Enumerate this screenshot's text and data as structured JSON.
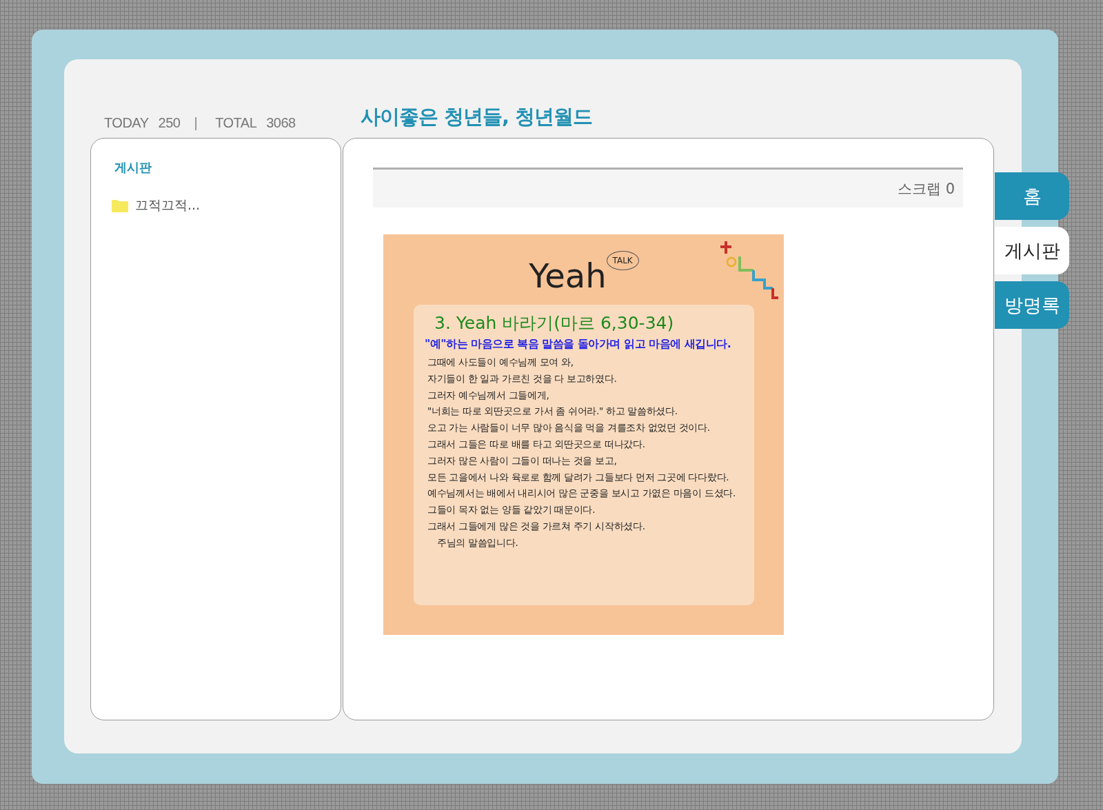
{
  "counter": {
    "today_label": "TODAY",
    "today": "250",
    "separator": "|",
    "total_label": "TOTAL",
    "total": "3068"
  },
  "site_title": "사이좋은 청년들, 청년월드",
  "sidebar": {
    "heading": "게시판",
    "items": [
      {
        "label": "끄적끄적..."
      }
    ]
  },
  "post": {
    "scrap": "스크랩 0",
    "card": {
      "logo": "Yeah",
      "logo_badge": "TALK",
      "title": "3. Yeah 바라기(마르 6,30-34)",
      "subtitle": "\"예\"하는 마음으로 복음 말씀을 돌아가며 읽고 마음에 새깁니다.",
      "lines": [
        {
          "kind": "verse",
          "text": "그때에 사도들이 예수님께 모여 와,"
        },
        {
          "kind": "verse",
          "text": "자기들이 한 일과 가르친 것을 다 보고하였다."
        },
        {
          "kind": "verse",
          "text": "그러자 예수님께서 그들에게,"
        },
        {
          "kind": "verse",
          "text": "\"너희는 따로 외딴곳으로 가서 좀 쉬어라.\" 하고 말씀하셨다."
        },
        {
          "kind": "verse",
          "text": "오고 가는 사람들이 너무 많아 음식을 먹을 겨를조차 없었던 것이다."
        },
        {
          "kind": "verse",
          "text": "그래서 그들은 따로 배를 타고 외딴곳으로 떠나갔다."
        },
        {
          "kind": "verse",
          "text": "그러자 많은 사람이 그들이 떠나는 것을 보고,"
        },
        {
          "kind": "verse",
          "text": "모든 고을에서 나와 육로로 함께 달려가 그들보다 먼저 그곳에 다다랐다."
        },
        {
          "kind": "verse",
          "text": "예수님께서는 배에서 내리시어 많은 군중을 보시고 가엾은 마음이 드셨다."
        },
        {
          "kind": "verse",
          "text": "그들이 목자 없는 양들 같았기 때문이다."
        },
        {
          "kind": "verse",
          "text": "그래서 그들에게 많은 것을 가르쳐 주기 시작하셨다."
        },
        {
          "kind": "closing",
          "text": "주님의 말씀입니다."
        }
      ]
    }
  },
  "tabs": [
    {
      "label": "홈",
      "selected": false
    },
    {
      "label": "게시판",
      "selected": true
    },
    {
      "label": "방명록",
      "selected": false
    }
  ]
}
